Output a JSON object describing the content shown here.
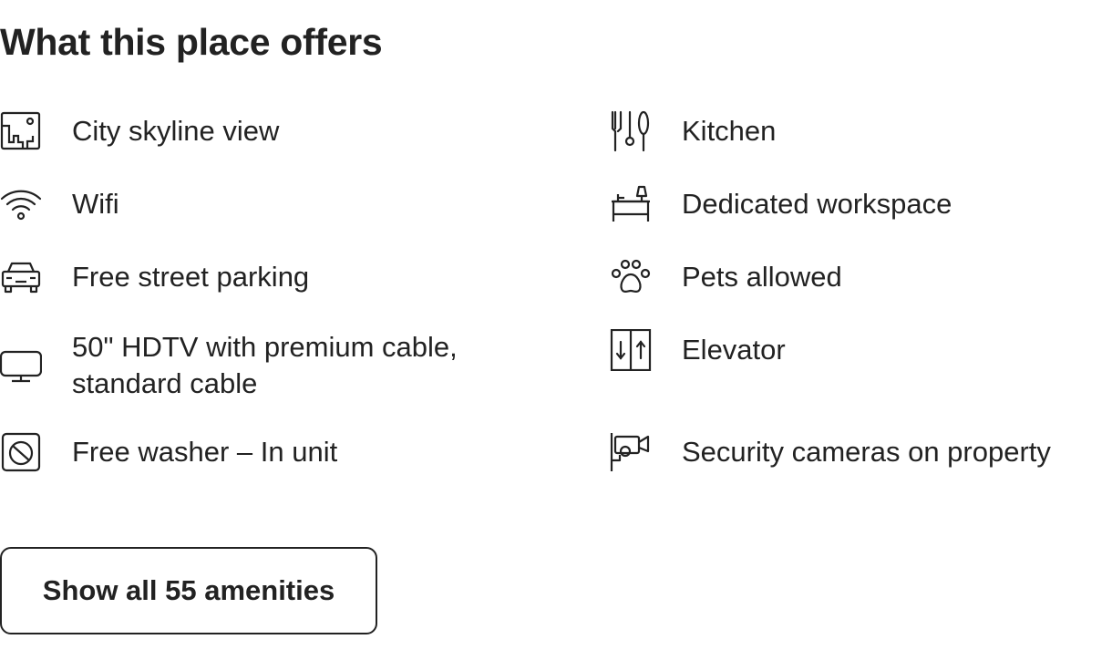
{
  "section_title": "What this place offers",
  "amenities_left": [
    {
      "label": "City skyline view",
      "icon": "city-skyline-icon"
    },
    {
      "label": "Wifi",
      "icon": "wifi-icon"
    },
    {
      "label": "Free street parking",
      "icon": "car-icon"
    },
    {
      "label": "50\" HDTV with premium cable,\nstandard cable",
      "icon": "tv-icon"
    },
    {
      "label": "Free washer – In unit",
      "icon": "washer-icon"
    }
  ],
  "amenities_right": [
    {
      "label": "Kitchen",
      "icon": "utensils-icon"
    },
    {
      "label": "Dedicated workspace",
      "icon": "desk-icon"
    },
    {
      "label": "Pets allowed",
      "icon": "paw-icon"
    },
    {
      "label": "Elevator",
      "icon": "elevator-icon"
    },
    {
      "label": "Security cameras on property",
      "icon": "security-camera-icon"
    }
  ],
  "show_all_button": {
    "label": "Show all 55 amenities"
  },
  "colors": {
    "text": "#222222",
    "background": "#ffffff",
    "border": "#222222"
  }
}
